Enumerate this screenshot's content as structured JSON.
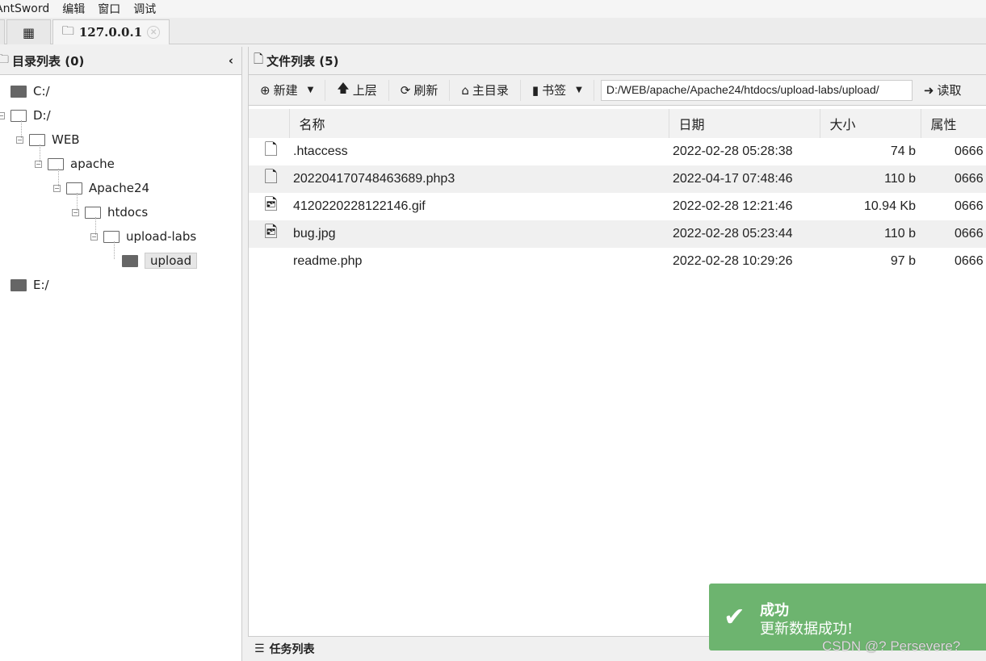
{
  "menu": [
    "AntSword",
    "编辑",
    "窗口",
    "调试"
  ],
  "tabs": {
    "active_label": "127.0.0.1"
  },
  "left_panel": {
    "title": "目录列表 (0)"
  },
  "tree": [
    {
      "label": "C:/",
      "depth": 0,
      "expanded": false,
      "filled": true
    },
    {
      "label": "D:/",
      "depth": 0,
      "expanded": true,
      "filled": false
    },
    {
      "label": "WEB",
      "depth": 1,
      "expanded": true,
      "filled": false
    },
    {
      "label": "apache",
      "depth": 2,
      "expanded": true,
      "filled": false
    },
    {
      "label": "Apache24",
      "depth": 3,
      "expanded": true,
      "filled": false
    },
    {
      "label": "htdocs",
      "depth": 4,
      "expanded": true,
      "filled": false
    },
    {
      "label": "upload-labs",
      "depth": 5,
      "expanded": true,
      "filled": false
    },
    {
      "label": "upload",
      "depth": 6,
      "expanded": false,
      "filled": true,
      "selected": true
    },
    {
      "label": "E:/",
      "depth": 0,
      "expanded": false,
      "filled": true
    }
  ],
  "right_panel": {
    "title": "文件列表 (5)"
  },
  "toolbar": {
    "new": "新建",
    "up": "上层",
    "refresh": "刷新",
    "home": "主目录",
    "bookmark": "书签",
    "path": "D:/WEB/apache/Apache24/htdocs/upload-labs/upload/",
    "read": "读取"
  },
  "columns": [
    "名称",
    "日期",
    "大小",
    "属性"
  ],
  "files": [
    {
      "icon": "file-icon",
      "name": ".htaccess",
      "date": "2022-02-28 05:28:38",
      "size": "74 b",
      "attr": "0666"
    },
    {
      "icon": "file-icon",
      "name": "202204170748463689.php3",
      "date": "2022-04-17 07:48:46",
      "size": "110 b",
      "attr": "0666"
    },
    {
      "icon": "image-file-icon",
      "name": "4120220228122146.gif",
      "date": "2022-02-28 12:21:46",
      "size": "10.94 Kb",
      "attr": "0666"
    },
    {
      "icon": "image-file-icon",
      "name": "bug.jpg",
      "date": "2022-02-28 05:23:44",
      "size": "110 b",
      "attr": "0666"
    },
    {
      "icon": "code-file-icon",
      "name": "readme.php",
      "date": "2022-02-28 10:29:26",
      "size": "97 b",
      "attr": "0666"
    }
  ],
  "tasks": {
    "title": "任务列表"
  },
  "toast": {
    "title": "成功",
    "message": "更新数据成功!",
    "color": "#6db46f"
  },
  "watermark": "CSDN @? Persevere?"
}
